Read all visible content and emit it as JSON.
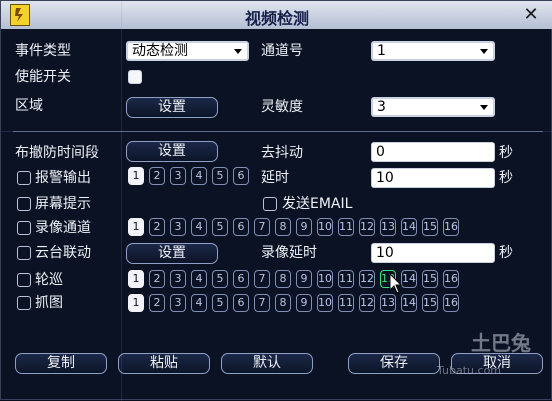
{
  "window": {
    "title": "视频检测",
    "close_icon": "close-icon"
  },
  "form": {
    "event_type": {
      "label": "事件类型",
      "value": "动态检测"
    },
    "channel": {
      "label": "通道号",
      "value": "1"
    },
    "enable": {
      "label": "使能开关"
    },
    "region": {
      "label": "区域",
      "button": "设置"
    },
    "sensitivity": {
      "label": "灵敏度",
      "value": "3"
    },
    "arm_period": {
      "label": "布撤防时间段",
      "button": "设置"
    },
    "debounce": {
      "label": "去抖动",
      "value": "0",
      "unit": "秒"
    },
    "alarm_out": {
      "label": "报警输出",
      "channels": [
        "1",
        "2",
        "3",
        "4",
        "5",
        "6"
      ],
      "selected": [
        "1"
      ]
    },
    "delay": {
      "label": "延时",
      "value": "10",
      "unit": "秒"
    },
    "screen_tip": {
      "label": "屏幕提示"
    },
    "send_email": {
      "label": "发送EMAIL"
    },
    "record_channel": {
      "label": "录像通道",
      "channels": [
        "1",
        "2",
        "3",
        "4",
        "5",
        "6",
        "7",
        "8",
        "9",
        "10",
        "11",
        "12",
        "13",
        "14",
        "15",
        "16"
      ],
      "selected": [
        "1"
      ]
    },
    "ptz_link": {
      "label": "云台联动",
      "button": "设置"
    },
    "record_delay": {
      "label": "录像延时",
      "value": "10",
      "unit": "秒"
    },
    "tour": {
      "label": "轮巡",
      "channels": [
        "1",
        "2",
        "3",
        "4",
        "5",
        "6",
        "7",
        "8",
        "9",
        "10",
        "11",
        "12",
        "13",
        "14",
        "15",
        "16"
      ],
      "selected": [
        "1"
      ],
      "hover": "13"
    },
    "snapshot": {
      "label": "抓图",
      "channels": [
        "1",
        "2",
        "3",
        "4",
        "5",
        "6",
        "7",
        "8",
        "9",
        "10",
        "11",
        "12",
        "13",
        "14",
        "15",
        "16"
      ],
      "selected": [
        "1"
      ]
    }
  },
  "footer": {
    "copy": "复制",
    "paste": "粘贴",
    "default": "默认",
    "save": "保存",
    "cancel": "取消"
  },
  "watermark": {
    "text": "土巴兔",
    "url": "Tubatu.com"
  }
}
